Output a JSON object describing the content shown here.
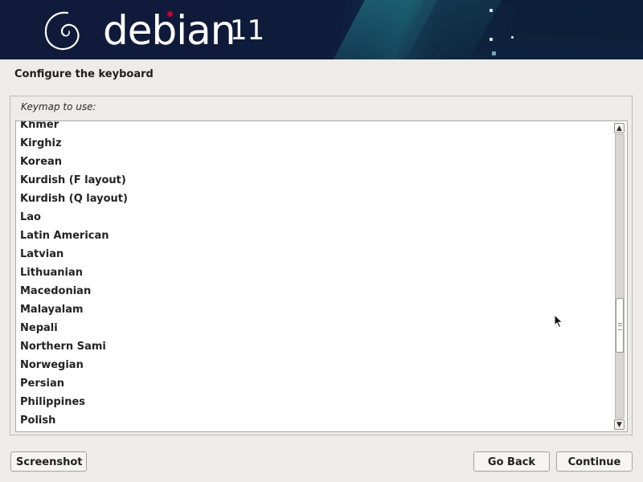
{
  "header": {
    "brand": "debian",
    "version": "11",
    "brand_accent_color": "#c70036",
    "background_color": "#101a3a"
  },
  "page_title": "Configure the keyboard",
  "prompt": "Keymap to use:",
  "keymaps": [
    "Khmer",
    "Kirghiz",
    "Korean",
    "Kurdish (F layout)",
    "Kurdish (Q layout)",
    "Lao",
    "Latin American",
    "Latvian",
    "Lithuanian",
    "Macedonian",
    "Malayalam",
    "Nepali",
    "Northern Sami",
    "Norwegian",
    "Persian",
    "Philippines",
    "Polish"
  ],
  "scrollbar": {
    "up_icon": "arrow-up-icon",
    "down_icon": "arrow-down-icon"
  },
  "buttons": {
    "screenshot": "Screenshot",
    "go_back": "Go Back",
    "continue": "Continue"
  }
}
